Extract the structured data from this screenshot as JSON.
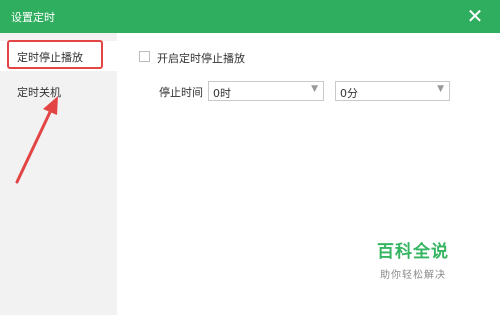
{
  "window": {
    "title": "设置定时",
    "close_glyph": "✕"
  },
  "sidebar": {
    "items": [
      {
        "label": "定时停止播放",
        "selected": true
      },
      {
        "label": "定时关机",
        "selected": false
      }
    ]
  },
  "main": {
    "enable_checkbox": {
      "label": "开启定时停止播放",
      "checked": false
    },
    "stop_time_label": "停止时间",
    "hour_select": {
      "value": "0时",
      "chevron": "▼"
    },
    "minute_select": {
      "value": "0分",
      "chevron": "▼"
    }
  },
  "watermark": {
    "title": "百科全说",
    "subtitle": "助你轻松解决"
  },
  "colors": {
    "titlebar": "#2fae5f",
    "annotation": "#e34545",
    "watermark": "#36b561"
  },
  "icons": {
    "close": "close-icon",
    "dropdown": "chevron-down-icon",
    "annotation": "arrow-icon"
  }
}
